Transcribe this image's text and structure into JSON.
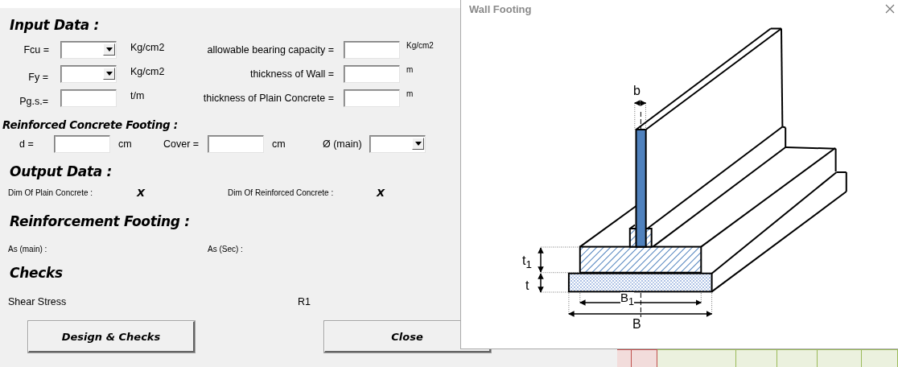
{
  "input_section": {
    "heading": "Input Data :",
    "rows": [
      {
        "label": "Fcu =",
        "field": {
          "kind": "combo"
        },
        "unit": "Kg/cm2",
        "label_2": "allowable bearing capacity =",
        "field_2": {
          "kind": "text"
        },
        "unit_2": "Kg/cm2"
      },
      {
        "label": "Fy =",
        "field": {
          "kind": "combo"
        },
        "unit": "Kg/cm2",
        "label_2": "thickness of Wall =",
        "field_2": {
          "kind": "text"
        },
        "unit_2": "m"
      },
      {
        "label": "Pg.s.=",
        "field": {
          "kind": "text"
        },
        "unit": "t/m",
        "label_2": "thickness of Plain Concrete =",
        "field_2": {
          "kind": "text"
        },
        "unit_2": "m"
      }
    ]
  },
  "reinforced_section": {
    "heading": "Reinforced Concrete Footing :",
    "fields": [
      {
        "label": "d =",
        "kind": "text",
        "unit": "cm"
      },
      {
        "label": "Cover =",
        "kind": "text",
        "unit": "cm"
      },
      {
        "label": "Ø (main)",
        "kind": "combo"
      }
    ]
  },
  "output_section": {
    "heading": "Output Data :",
    "items": [
      {
        "label": "Dim Of Plain Concrete :",
        "value": "X"
      },
      {
        "label": "Dim Of Reinforced Concrete :",
        "value": "X"
      }
    ]
  },
  "reinforcement_section": {
    "heading": "Reinforcement Footing :",
    "items": [
      {
        "label": "As (main) :"
      },
      {
        "label": "As (Sec) :"
      }
    ]
  },
  "checks_section": {
    "heading": "Checks",
    "items": [
      {
        "label": "Shear Stress",
        "value": "R1"
      }
    ]
  },
  "buttons": [
    "Design & Checks",
    "Close"
  ],
  "diagram_window": {
    "title": "Wall Footing",
    "dimension_labels": {
      "wall_thickness": "b",
      "footing_depth": "t$_{1}$",
      "plain_thickness": "t",
      "footing_width": "B$_{1}$",
      "plain_width": "B"
    }
  }
}
